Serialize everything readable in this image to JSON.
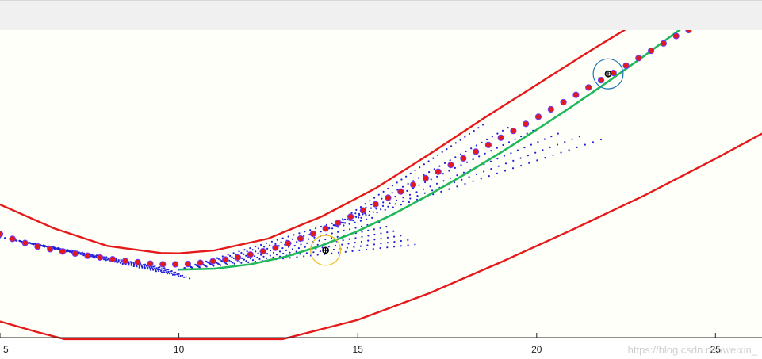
{
  "watermark": "https://blog.csdn.net/weixin_",
  "colors": {
    "figure_bg": "#ffffff",
    "axes_bg": "#fffffa",
    "road_edge": "#e41a1a",
    "waypoint_fill": "#e41a1a",
    "waypoint_edge": "#6a3dff",
    "candidate_paths": "#2020d8",
    "selected_path": "#1fb85a",
    "vehicle_circle_1": "#1f77b4",
    "vehicle_circle_2": "#f0c020",
    "vehicle_marker": "#000000"
  },
  "chart_data": {
    "type": "line",
    "xlim": [
      5,
      26.3
    ],
    "ylim": [
      -2.6,
      7.8
    ],
    "xticks": [
      5,
      10,
      15,
      20,
      25
    ],
    "xtick_labels": [
      "5",
      "10",
      "15",
      "20",
      "25"
    ],
    "grid": false,
    "legend": "none",
    "series": [
      {
        "kind": "road_upper",
        "x": [
          5,
          6.5,
          8,
          9.5,
          10,
          11,
          12.5,
          14,
          15.5,
          17,
          18.5,
          20,
          21.5,
          23
        ],
        "y": [
          1.9,
          1.1,
          0.5,
          0.26,
          0.25,
          0.35,
          0.75,
          1.5,
          2.45,
          3.6,
          4.8,
          5.95,
          7.1,
          8.2
        ]
      },
      {
        "kind": "road_lower",
        "x": [
          5,
          6,
          6.8,
          12.9,
          15,
          17,
          19,
          21,
          23,
          25,
          26.3
        ],
        "y": [
          -2.05,
          -2.4,
          -2.65,
          -2.65,
          -2.0,
          -1.1,
          -0.05,
          1.05,
          2.2,
          3.45,
          4.3
        ]
      },
      {
        "kind": "reference_waypoints",
        "x": [
          5,
          5.35,
          5.7,
          6.05,
          6.4,
          6.75,
          7.1,
          7.45,
          7.8,
          8.15,
          8.5,
          8.85,
          9.2,
          9.55,
          9.9,
          10.25,
          10.6,
          10.95,
          11.3,
          11.65,
          12.0,
          12.35,
          12.7,
          13.05,
          13.4,
          13.75,
          14.1,
          14.45,
          14.8,
          15.15,
          15.5,
          15.85,
          16.2,
          16.55,
          16.9,
          17.25,
          17.6,
          17.95,
          18.3,
          18.65,
          19.0,
          19.35,
          19.7,
          20.05,
          20.4,
          20.75,
          21.1,
          21.45,
          21.8,
          22.15,
          22.5,
          22.85,
          23.2,
          23.55,
          23.9,
          24.25,
          24.6
        ],
        "y": [
          0.9,
          0.74,
          0.6,
          0.48,
          0.39,
          0.31,
          0.24,
          0.17,
          0.11,
          0.05,
          -0.01,
          -0.05,
          -0.1,
          -0.12,
          -0.12,
          -0.11,
          -0.07,
          -0.02,
          0.04,
          0.11,
          0.21,
          0.32,
          0.44,
          0.59,
          0.75,
          0.91,
          1.09,
          1.28,
          1.49,
          1.7,
          1.91,
          2.13,
          2.34,
          2.57,
          2.79,
          3.01,
          3.24,
          3.46,
          3.69,
          3.92,
          4.16,
          4.39,
          4.63,
          4.87,
          5.12,
          5.36,
          5.61,
          5.86,
          6.11,
          6.35,
          6.6,
          6.85,
          7.1,
          7.35,
          7.6,
          7.8,
          7.98
        ]
      },
      {
        "kind": "selected_path",
        "x": [
          10,
          11,
          12,
          13,
          14,
          15,
          16,
          17,
          18,
          19,
          20,
          21,
          22,
          23,
          24,
          24.3
        ],
        "y": [
          -0.3,
          -0.27,
          -0.12,
          0.14,
          0.52,
          1.0,
          1.58,
          2.23,
          2.93,
          3.66,
          4.43,
          5.23,
          6.06,
          6.92,
          7.81,
          8.0
        ]
      },
      {
        "kind": "candidate_paths",
        "fan_1": {
          "x0": 5.0,
          "y0": 0.8,
          "x_end": [
            9.6,
            9.7,
            9.8,
            9.9,
            10.0,
            10.1,
            10.2,
            10.3
          ],
          "y_end": [
            -0.25,
            -0.3,
            -0.35,
            -0.4,
            -0.45,
            -0.5,
            -0.55,
            -0.6
          ]
        },
        "fan_2": {
          "x0": 10.0,
          "y0": -0.3,
          "x_end": [
            15.2,
            15.4,
            15.6,
            15.8,
            16.0,
            16.2,
            16.4,
            16.6
          ],
          "y_end": [
            1.6,
            1.45,
            1.3,
            1.15,
            1.0,
            0.85,
            0.7,
            0.55
          ]
        },
        "fan_3": {
          "x0": 14.2,
          "y0": 1.1,
          "x_end": [
            18.5,
            19.2,
            19.9,
            20.6,
            21.2,
            21.8
          ],
          "y_end": [
            4.6,
            4.5,
            4.4,
            4.3,
            4.2,
            4.1
          ]
        }
      },
      {
        "kind": "vehicle",
        "positions": [
          {
            "x": 14.1,
            "y": 0.35,
            "radius": 0.42,
            "circle": "vehicle_circle_2"
          },
          {
            "x": 22.0,
            "y": 6.32,
            "radius": 0.42,
            "circle": "vehicle_circle_1"
          }
        ]
      }
    ]
  }
}
